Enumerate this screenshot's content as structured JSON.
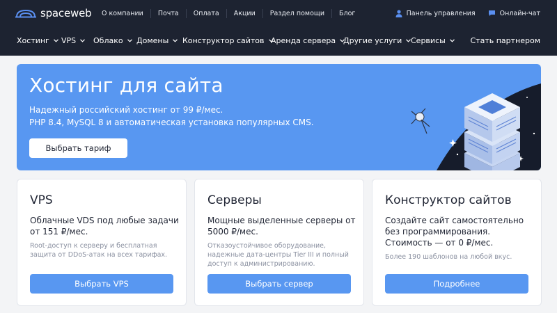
{
  "header": {
    "logo_text": "spaceweb",
    "top_links": [
      "О компании",
      "Почта",
      "Оплата",
      "Акции",
      "Раздел помощи",
      "Блог"
    ],
    "control_panel": "Панель управления",
    "online_chat": "Онлайн-чат",
    "nav": [
      "Хостинг",
      "VPS",
      "Облако",
      "Домены",
      "Конструктор сайтов",
      "Аренда сервера",
      "Другие услуги",
      "Сервисы"
    ],
    "partner": "Стать партнером"
  },
  "hero": {
    "title": "Хостинг для сайта",
    "line1": "Надежный российский хостинг от 99 ₽/мес.",
    "line2": "PHP 8.4, MySQL 8 и автоматическая установка популярных CMS.",
    "button": "Выбрать тариф"
  },
  "cards": [
    {
      "title": "VPS",
      "desc": "Облачные VDS под любые задачи от 151 ₽/мес.",
      "note": "Root-доступ к серверу и бесплатная защита от DDoS-атак на всех тарифах.",
      "button": "Выбрать VPS"
    },
    {
      "title": "Серверы",
      "desc": "Мощные выделенные серверы от 5000 ₽/мес.",
      "note": "Отказоустойчивое оборудование, надежные дата-центры Tier III и полный доступ к администрированию.",
      "button": "Выбрать сервер"
    },
    {
      "title": "Конструктор сайтов",
      "desc": "Создайте сайт самостоятельно без программирования. Стоимость — от 0 ₽/мес.",
      "note": "Более 190 шаблонов на любой вкус.",
      "button": "Подробнее"
    }
  ],
  "colors": {
    "header_bg": "#1d2331",
    "accent": "#5897f1",
    "page_bg": "#f3f4f6"
  }
}
